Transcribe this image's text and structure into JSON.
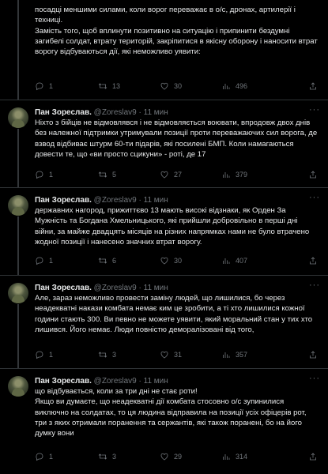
{
  "author": {
    "name": "Пан Зореслав.",
    "handle": "@Zoreslav9",
    "separator": "·"
  },
  "icons": {
    "more": "more-horizontal-icon",
    "reply": "reply-bubble-icon",
    "retweet": "retweet-icon",
    "like": "heart-icon",
    "views": "analytics-bars-icon",
    "share": "share-upload-icon"
  },
  "tweets": [
    {
      "time": "11 мин",
      "lines": [
        "посадці меншими силами, коли ворог переважає в о/с, дронах, артилерії і техниці.",
        "Замість того, щоб вплинути позитивно на ситуацію і припинити бездумні загибелі солдат, втрату територій, закріпитися в якісну оборону і наносити втрат ворогу відбуваються дії, які неможливо уявити:"
      ],
      "replies": "1",
      "retweets": "13",
      "likes": "30",
      "views": "496"
    },
    {
      "time": "11 мин",
      "lines": [
        "Ніхто з бійців не відмовлявся і не відмовляється воювати, впродовж двох днів без належної підтримки утримували позиції проти переважаючих сил ворога, де взвод відбиває штурм 60-ти підарів, які посилені БМП. Коли намагаються довести те, що «ви просто сцикуни» - роті, де 17"
      ],
      "replies": "1",
      "retweets": "5",
      "likes": "27",
      "views": "379"
    },
    {
      "time": "11 мин",
      "lines": [
        "державних нагород, прижиттєво 13 мають високі відзнаки, як Орден За Мужність та Богдана Хмельницького, які прийшли добровільно в перші дні війни, за майже двадцять місяців на різних напрямках нами не було втрачено жодної позиції і нанесено значних втрат ворогу."
      ],
      "replies": "1",
      "retweets": "6",
      "likes": "30",
      "views": "407"
    },
    {
      "time": "11 мин",
      "lines": [
        "Але, зараз неможливо провести заміну людей, що лишилися, бо через неадекватні накази комбата немає ким це зробити, а ті хто лишилися кожної години стають 300. Ви певно не можете уявити, який моральний стан у тих хто лишився. Його немає. Люди повністю деморалізовані від того,"
      ],
      "replies": "1",
      "retweets": "3",
      "likes": "31",
      "views": "357"
    },
    {
      "time": "11 мин",
      "lines": [
        "що відбувається, коли за три дні не стає роти!",
        "Якщо ви думаєте, що неадекватні дії комбата стосовно о/с зупинилися виключно на солдатах, то ця людина відправила на позиції усіх офіцерів рот, три з яких отримали поранення та сержантів, які також поранені, бо на його думку вони"
      ],
      "replies": "1",
      "retweets": "3",
      "likes": "29",
      "views": "314"
    }
  ]
}
